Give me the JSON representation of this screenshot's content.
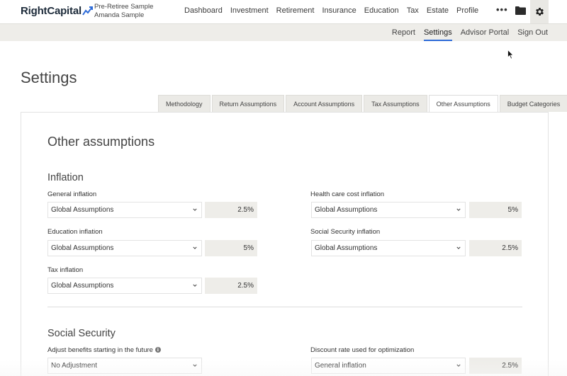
{
  "brand": {
    "name": "RightCapital",
    "accent": "#2d6bd8"
  },
  "client": {
    "line1": "Pre-Retiree Sample",
    "line2": "Amanda Sample"
  },
  "mainnav": [
    "Dashboard",
    "Investment",
    "Retirement",
    "Insurance",
    "Education",
    "Tax",
    "Estate",
    "Profile"
  ],
  "header_icons": {
    "more": "•••",
    "folder": "folder-icon",
    "settings": "gear-icon"
  },
  "subnav": {
    "items": [
      "Report",
      "Settings",
      "Advisor Portal",
      "Sign Out"
    ],
    "active": "Settings"
  },
  "page_title": "Settings",
  "tabs": {
    "items": [
      "Methodology",
      "Return Assumptions",
      "Account Assumptions",
      "Tax Assumptions",
      "Other Assumptions",
      "Budget Categories"
    ],
    "active": "Other Assumptions"
  },
  "panel_title": "Other assumptions",
  "inflation": {
    "heading": "Inflation",
    "general": {
      "label": "General inflation",
      "select": "Global Assumptions",
      "value": "2.5%"
    },
    "health": {
      "label": "Health care cost inflation",
      "select": "Global Assumptions",
      "value": "5%"
    },
    "education": {
      "label": "Education inflation",
      "select": "Global Assumptions",
      "value": "5%"
    },
    "social_security": {
      "label": "Social Security inflation",
      "select": "Global Assumptions",
      "value": "2.5%"
    },
    "tax": {
      "label": "Tax inflation",
      "select": "Global Assumptions",
      "value": "2.5%"
    }
  },
  "social_security": {
    "heading": "Social Security",
    "adjust": {
      "label": "Adjust benefits starting in the future",
      "select": "No Adjustment"
    },
    "discount": {
      "label": "Discount rate used for optimization",
      "select": "General inflation",
      "value": "2.5%"
    }
  }
}
